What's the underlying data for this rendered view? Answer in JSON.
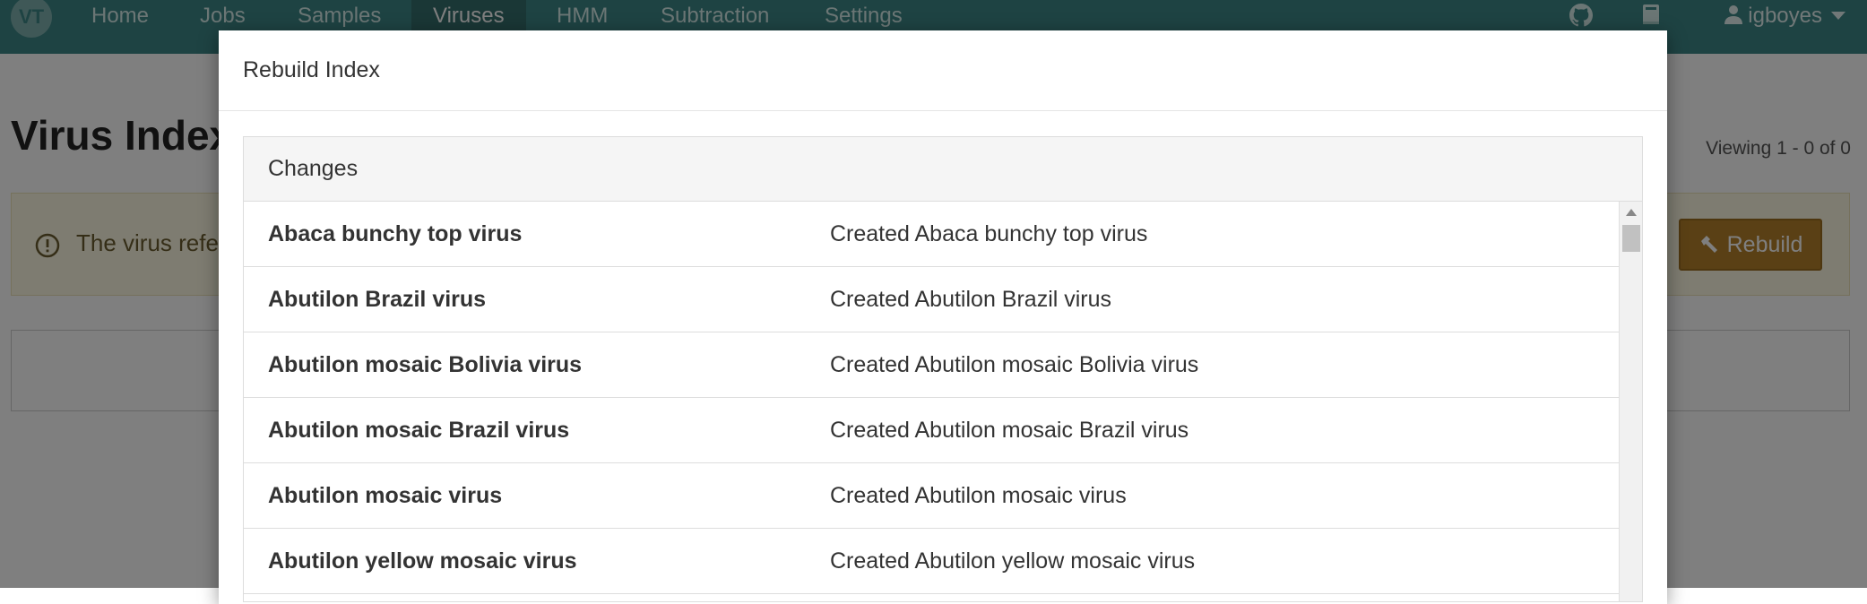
{
  "navbar": {
    "logo_text": "VT",
    "items": [
      {
        "label": "Home"
      },
      {
        "label": "Jobs"
      },
      {
        "label": "Samples"
      },
      {
        "label": "Viruses"
      },
      {
        "label": "HMM"
      },
      {
        "label": "Subtraction"
      },
      {
        "label": "Settings"
      }
    ],
    "active_item": "Viruses",
    "github_icon": "github-icon",
    "docs_icon": "book-icon",
    "user": {
      "icon": "user-icon",
      "name": "igboyes",
      "caret_icon": "caret-down-icon"
    }
  },
  "page": {
    "title": "Virus Indexes",
    "viewing": "Viewing 1 - 0 of 0",
    "alert": {
      "icon": "exclamation-circle-icon",
      "text": "The virus reference database has changed and the index must be rebuilt before the new content will be included in future analyses.",
      "visible_text": "The virus refer",
      "button_label": "Rebuild",
      "button_icon": "hammer-icon"
    }
  },
  "modal": {
    "title": "Rebuild Index",
    "panel_heading": "Changes",
    "changes": [
      {
        "name": "Abaca bunchy top virus",
        "description": "Created Abaca bunchy top virus"
      },
      {
        "name": "Abutilon Brazil virus",
        "description": "Created Abutilon Brazil virus"
      },
      {
        "name": "Abutilon mosaic Bolivia virus",
        "description": "Created Abutilon mosaic Bolivia virus"
      },
      {
        "name": "Abutilon mosaic Brazil virus",
        "description": "Created Abutilon mosaic Brazil virus"
      },
      {
        "name": "Abutilon mosaic virus",
        "description": "Created Abutilon mosaic virus"
      },
      {
        "name": "Abutilon yellow mosaic virus",
        "description": "Created Abutilon yellow mosaic virus"
      }
    ]
  },
  "colors": {
    "navbar": "#3c8786",
    "navbar_active": "#346e6d",
    "alert_bg": "#fcf8e3",
    "rebuild_button": "#b5812a"
  }
}
